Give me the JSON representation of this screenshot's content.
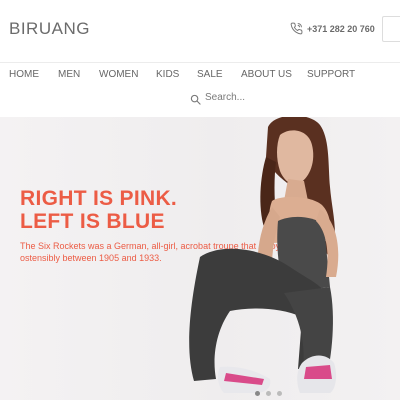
{
  "header": {
    "logo": "BIRUANG",
    "phone": "+371 282 20 760",
    "phone_icon": "phone-icon"
  },
  "nav": {
    "items": [
      "HOME",
      "MEN",
      "WOMEN",
      "KIDS",
      "SALE",
      "ABOUT US",
      "SUPPORT"
    ]
  },
  "search": {
    "placeholder": "Search...",
    "icon": "search-icon"
  },
  "hero": {
    "title_line1": "RIGHT IS PINK.",
    "title_line2": "LEFT IS BLUE",
    "text": "The Six Rockets was a German, all-girl, acrobat troupe that enjoyed ostensibly between 1905 and 1933.",
    "accent_color": "#ec5c45"
  }
}
